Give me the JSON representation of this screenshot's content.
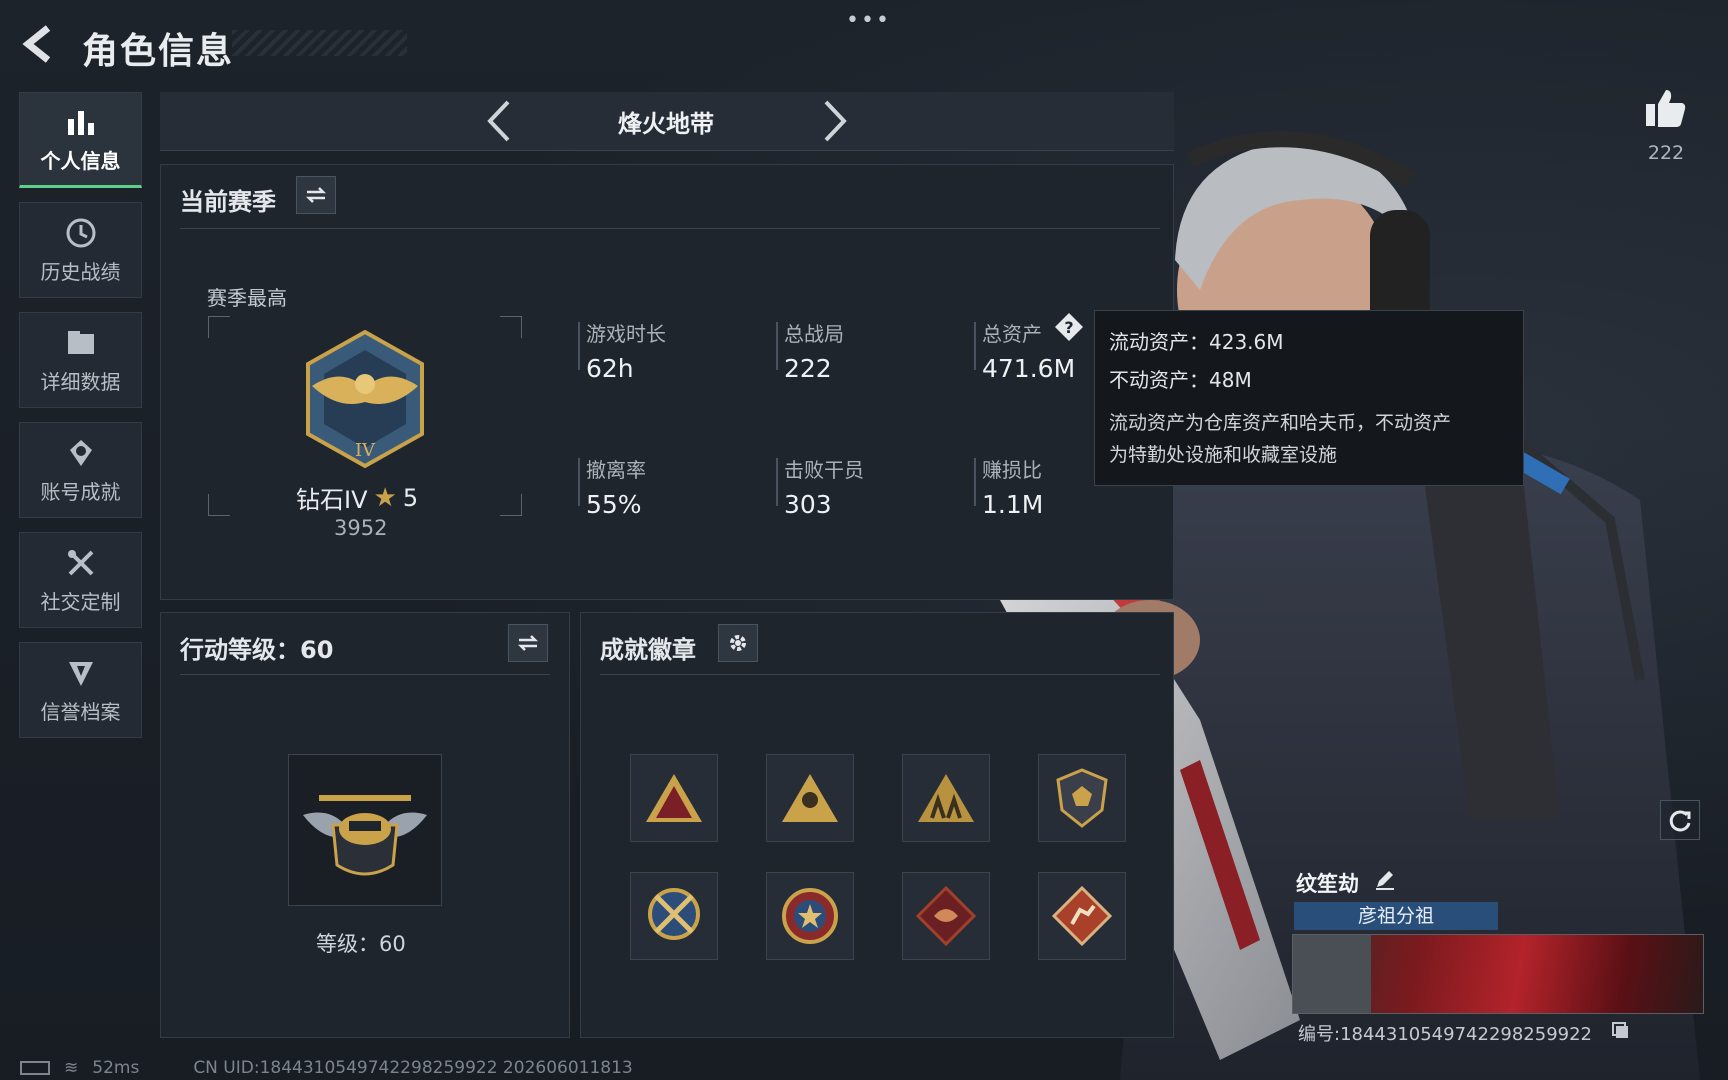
{
  "header": {
    "title": "角色信息"
  },
  "sidebar": {
    "items": [
      {
        "label": "个人信息",
        "icon": "bar-chart-icon",
        "active": true
      },
      {
        "label": "历史战绩",
        "icon": "history-icon",
        "active": false
      },
      {
        "label": "详细数据",
        "icon": "folder-icon",
        "active": false
      },
      {
        "label": "账号成就",
        "icon": "achievement-icon",
        "active": false
      },
      {
        "label": "社交定制",
        "icon": "tools-icon",
        "active": false
      },
      {
        "label": "信誉档案",
        "icon": "credit-shield-icon",
        "active": false
      }
    ]
  },
  "mode": {
    "title": "烽火地带"
  },
  "season": {
    "heading": "当前赛季",
    "best_label": "赛季最高",
    "rank_name": "钻石IV",
    "rank_stars": "5",
    "rank_score": "3952",
    "stats": [
      {
        "label": "游戏时长",
        "value": "62h"
      },
      {
        "label": "总战局",
        "value": "222"
      },
      {
        "label": "总资产",
        "value": "471.6M"
      },
      {
        "label": "撤离率",
        "value": "55%"
      },
      {
        "label": "击败干员",
        "value": "303"
      },
      {
        "label": "赚损比",
        "value": "1.1M"
      }
    ]
  },
  "tooltip": {
    "liquid": "流动资产：423.6M",
    "fixed": "不动资产：48M",
    "desc_line1": "流动资产为仓库资产和哈夫币，不动资产",
    "desc_line2": "为特勤处设施和收藏室设施"
  },
  "action_level": {
    "heading": "行动等级：60",
    "level_text": "等级：60"
  },
  "badges": {
    "heading": "成就徽章",
    "count": 8
  },
  "profile": {
    "likes": "222",
    "name": "纹笙劫",
    "group": "彦祖分祖",
    "id_text": "编号:1844310549742298259922"
  },
  "footer": {
    "ping": "52ms",
    "uid": "CN UID:1844310549742298259922 202606011813"
  },
  "colors": {
    "accent_green": "#5fd08a",
    "tag_blue": "#2a4e7a",
    "gold": "#c9a24a"
  }
}
